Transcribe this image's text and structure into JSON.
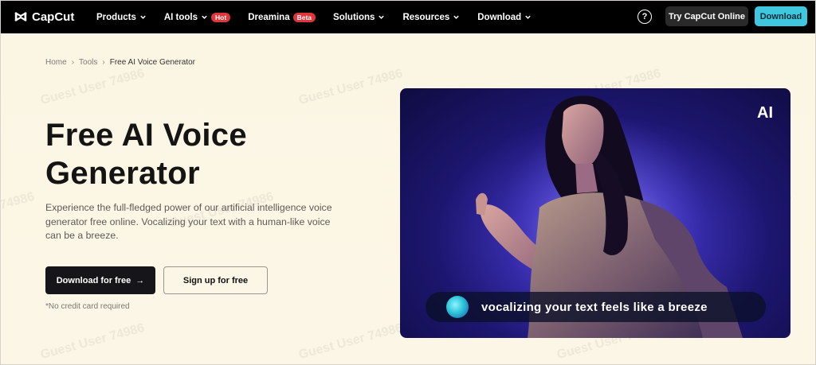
{
  "brand": {
    "name": "CapCut"
  },
  "nav": {
    "items": [
      {
        "label": "Products",
        "badge": ""
      },
      {
        "label": "AI tools",
        "badge": "Hot"
      },
      {
        "label": "Dreamina",
        "badge": "Beta"
      },
      {
        "label": "Solutions",
        "badge": ""
      },
      {
        "label": "Resources",
        "badge": ""
      },
      {
        "label": "Download",
        "badge": ""
      }
    ],
    "help_icon": "question-circle-icon",
    "help_symbol": "?",
    "try_online": "Try CapCut Online",
    "download": "Download"
  },
  "breadcrumb": {
    "home": "Home",
    "tools": "Tools",
    "current": "Free AI Voice Generator",
    "separator": "›"
  },
  "hero": {
    "title": "Free AI Voice Generator",
    "description": "Experience the full-fledged power of our artificial intelligence voice generator free online. Vocalizing your text with a human-like voice can be a breeze.",
    "download_btn": "Download for free",
    "download_arrow": "→",
    "signup_btn": "Sign up for free",
    "note": "*No credit card required"
  },
  "media": {
    "ai_label": "AI",
    "caption": "vocalizing your text feels like a breeze"
  },
  "watermark": "Guest User 74986",
  "colors": {
    "nav_bg": "#000000",
    "accent": "#3ec7de",
    "badge": "#e0353b",
    "page_bg": "#fbf5e4"
  }
}
